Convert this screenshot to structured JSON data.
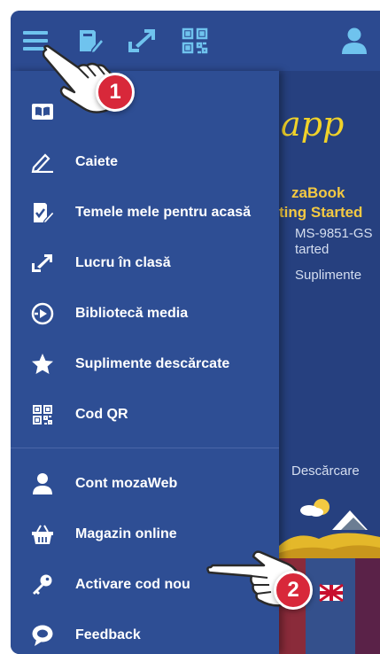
{
  "background_app": {
    "title": "app",
    "line1": "zaBook",
    "line2": "ting Started",
    "line3": "MS-9851-GS",
    "line4": "tarted",
    "line5": "Suplimente",
    "download": "Descărcare"
  },
  "topbar": {
    "icons": [
      "menu-icon",
      "book-edit-icon",
      "classroom-icon",
      "qr-code-icon",
      "user-icon"
    ]
  },
  "menu": {
    "items": [
      {
        "label": "",
        "icon": "open-book-icon"
      },
      {
        "label": "Caiete",
        "icon": "pen-icon"
      },
      {
        "label": "Temele mele pentru acasă",
        "icon": "homework-icon"
      },
      {
        "label": "Lucru în clasă",
        "icon": "classroom-icon"
      },
      {
        "label": "Bibliotecă media",
        "icon": "media-icon"
      },
      {
        "label": "Suplimente descărcate",
        "icon": "star-icon"
      },
      {
        "label": "Cod QR",
        "icon": "qr-code-icon"
      },
      {
        "label": "Cont mozaWeb",
        "icon": "user-icon"
      },
      {
        "label": "Magazin online",
        "icon": "basket-icon"
      },
      {
        "label": "Activare cod nou",
        "icon": "key-icon"
      },
      {
        "label": "Feedback",
        "icon": "feedback-icon"
      }
    ]
  },
  "annotations": {
    "step1": "1",
    "step2": "2"
  },
  "colors": {
    "drawer": "#2e4e94",
    "topbar": "#2c4a90",
    "badge": "#d8283a",
    "accent_yellow": "#f3c942"
  }
}
